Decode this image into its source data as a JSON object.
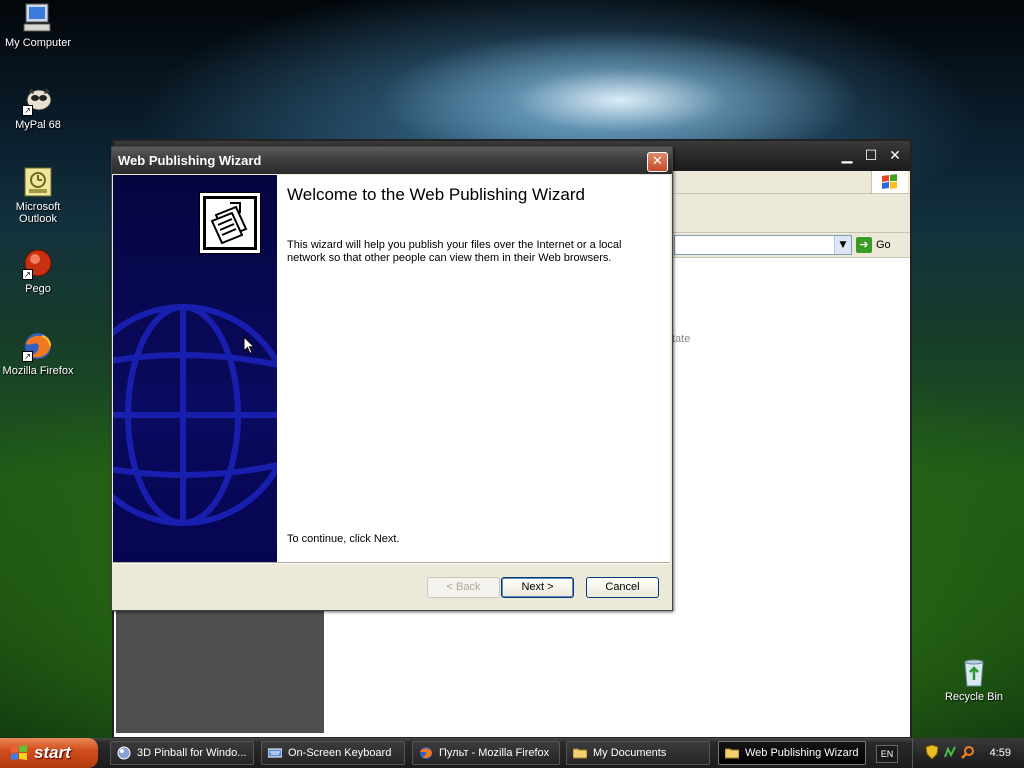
{
  "desktop": {
    "icons": [
      {
        "label": "My Computer"
      },
      {
        "label": "MyPal 68"
      },
      {
        "label": "Microsoft Outlook"
      },
      {
        "label": "Pego"
      },
      {
        "label": "Mozilla Firefox"
      },
      {
        "label": "Recycle Bin"
      }
    ]
  },
  "explorer": {
    "go_label": "Go",
    "partial_text": "tate"
  },
  "wizard": {
    "title": "Web Publishing Wizard",
    "close_symbol": "✕",
    "heading": "Welcome to the Web Publishing Wizard",
    "description": "This wizard will help you publish your files over the Internet or a local network so that other people can view them in their Web browsers.",
    "continue_text": "To continue, click Next.",
    "buttons": {
      "back": "< Back",
      "next": "Next >",
      "cancel": "Cancel"
    }
  },
  "taskbar": {
    "start_label": "start",
    "items": [
      {
        "label": "3D Pinball for Windo...",
        "icon": "pinball-icon"
      },
      {
        "label": "On-Screen Keyboard",
        "icon": "keyboard-icon"
      },
      {
        "label": "Пульт - Mozilla Firefox",
        "icon": "firefox-icon"
      },
      {
        "label": "My Documents",
        "icon": "folder-icon"
      },
      {
        "label": "Web Publishing Wizard",
        "icon": "folder-icon",
        "active": true
      }
    ],
    "language": "EN",
    "clock": "4:59"
  }
}
